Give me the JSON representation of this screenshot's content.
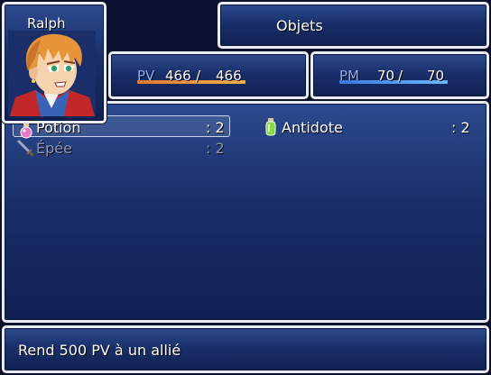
{
  "actor": {
    "name": "Ralph",
    "hp_label": "PV",
    "hp_current": "466",
    "hp_max": "466",
    "hp_fraction": 1.0,
    "mp_label": "PM",
    "mp_current": "70",
    "mp_max": "70",
    "mp_fraction": 1.0
  },
  "window_title": "Objets",
  "items": [
    {
      "name": "Potion",
      "count": ": 2",
      "icon": "potion-icon",
      "enabled": true,
      "selected": true
    },
    {
      "name": "Antidote",
      "count": ": 2",
      "icon": "antidote-icon",
      "enabled": true,
      "selected": false
    },
    {
      "name": "Épée",
      "count": ": 2",
      "icon": "sword-icon",
      "enabled": false,
      "selected": false
    }
  ],
  "help_text": "Rend 500 PV à un allié",
  "colors": {
    "window_top": "#2c4a8e",
    "window_bottom": "#0f2052",
    "border": "#e8ecf4",
    "system_label": "#8cb0ff",
    "hp_gauge": "#f0b048",
    "mp_gauge": "#6ab8ff",
    "disabled_text": "#8c97b4"
  }
}
